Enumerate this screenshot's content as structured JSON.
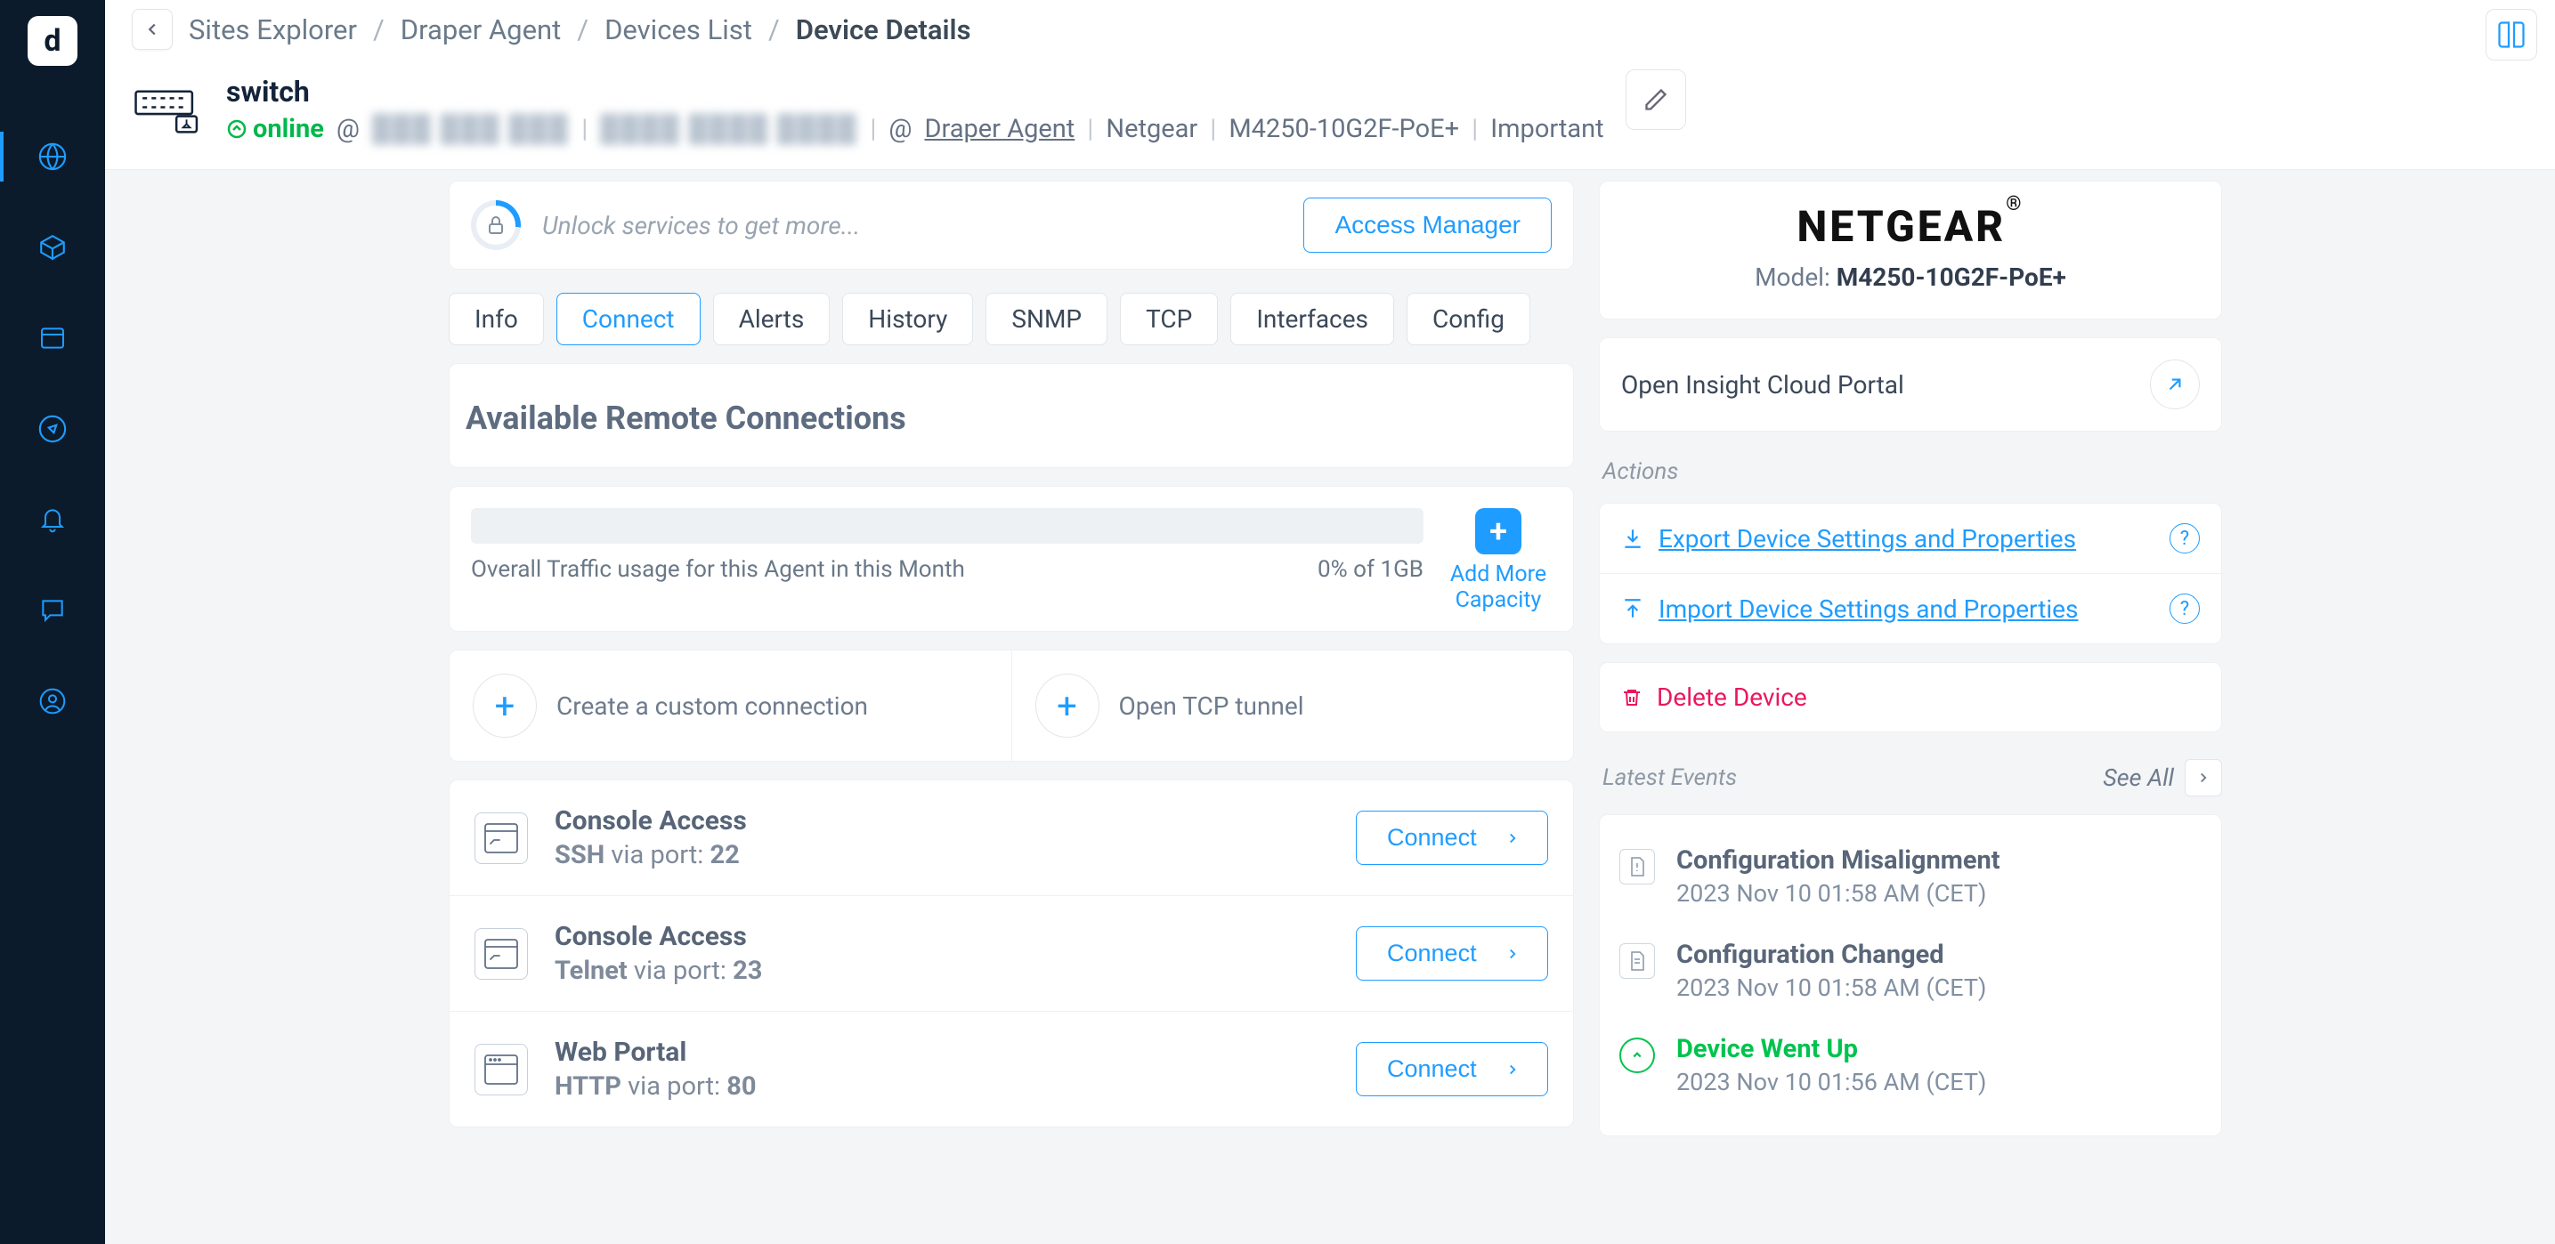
{
  "breadcrumb": {
    "items": [
      "Sites Explorer",
      "Draper Agent",
      "Devices List",
      "Device Details"
    ]
  },
  "device": {
    "name": "switch",
    "status": "online",
    "at": "@",
    "redacted1": "███ ███ ███",
    "redacted2": "████ ████ ████",
    "agent_at": "@",
    "agent": "Draper Agent",
    "vendor": "Netgear",
    "model": "M4250-10G2F-PoE+",
    "priority": "Important"
  },
  "unlock": {
    "text": "Unlock services to get more...",
    "button": "Access Manager"
  },
  "tabs": [
    "Info",
    "Connect",
    "Alerts",
    "History",
    "SNMP",
    "TCP",
    "Interfaces",
    "Config"
  ],
  "active_tab": "Connect",
  "section_title": "Available Remote Connections",
  "traffic": {
    "label": "Overall Traffic usage for this Agent in this Month",
    "usage": "0% of 1GB",
    "add_more": "Add More Capacity"
  },
  "create": {
    "custom": "Create a custom connection",
    "tunnel": "Open TCP tunnel"
  },
  "connections": [
    {
      "name": "Console Access",
      "proto": "SSH",
      "via": " via port: ",
      "port": "22",
      "button": "Connect",
      "icon": "terminal"
    },
    {
      "name": "Console Access",
      "proto": "Telnet",
      "via": " via port: ",
      "port": "23",
      "button": "Connect",
      "icon": "terminal"
    },
    {
      "name": "Web Portal",
      "proto": "HTTP",
      "via": " via port: ",
      "port": "80",
      "button": "Connect",
      "icon": "browser"
    }
  ],
  "brand": {
    "logo": "NETGEAR",
    "model_label": "Model: ",
    "model": "M4250-10G2F-PoE+"
  },
  "portal_link": "Open Insight Cloud Portal",
  "actions_heading": "Actions",
  "actions": {
    "export": "Export Device Settings and Properties",
    "import": "Import Device Settings and Properties",
    "delete": "Delete Device"
  },
  "events_heading": "Latest Events",
  "see_all": "See All",
  "events": [
    {
      "title": "Configuration Misalignment",
      "time": "2023 Nov 10 01:58 AM (CET)",
      "icon": "doc"
    },
    {
      "title": "Configuration Changed",
      "time": "2023 Nov 10 01:58 AM (CET)",
      "icon": "doc"
    },
    {
      "title": "Device Went Up",
      "time": "2023 Nov 10 01:56 AM (CET)",
      "icon": "up"
    }
  ]
}
